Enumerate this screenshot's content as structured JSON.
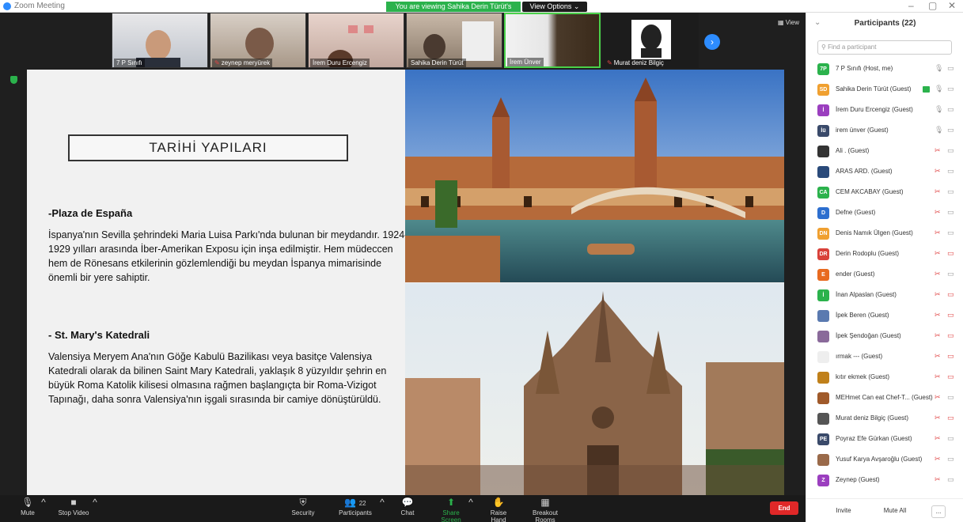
{
  "window": {
    "title": "Zoom Meeting",
    "viewing_banner": "You are viewing Sahika Derin Türüt's screen",
    "view_options": "View Options ⌄",
    "view_label": "View"
  },
  "thumbnails": [
    {
      "name": "7 P Sınıfı",
      "muted": false
    },
    {
      "name": "zeynep meryürek",
      "muted": true
    },
    {
      "name": "İrem Duru Ercengiz",
      "muted": false
    },
    {
      "name": "Sahika Derin Türüt",
      "muted": false
    },
    {
      "name": "İrem Ünver",
      "muted": false
    },
    {
      "name": "Murat deniz Bilgiç",
      "muted": true
    }
  ],
  "slide": {
    "title": "TARİHİ YAPILARI",
    "h1": "-Plaza de España",
    "p1": "İspanya'nın Sevilla şehrindeki Maria Luisa Parkı'nda bulunan bir meydandır. 1924-1929 yılları arasında İber-Amerikan Exposu için inşa edilmiştir. Hem müdeccen hem de Rönesans etkilerinin gözlemlendiği bu meydan İspanya mimarisinde önemli bir yere sahiptir.",
    "h2": "- St. Mary's Katedrali",
    "p2": "Valensiya Meryem Ana'nın Göğe Kabulü Bazilikası veya basitçe Valensiya Katedrali olarak da bilinen Saint Mary Katedrali, yaklaşık 8 yüzyıldır şehrin en büyük Roma Katolik kilisesi olmasına rağmen başlangıçta bir Roma-Vizigot Tapınağı, daha sonra Valensiya'nın işgali sırasında bir camiye dönüştürüldü."
  },
  "toolbar": {
    "mute": "Mute",
    "stop_video": "Stop Video",
    "security": "Security",
    "participants": "Participants",
    "participants_count": "22",
    "chat": "Chat",
    "share_screen": "Share Screen",
    "raise_hand": "Raise Hand",
    "breakout_rooms": "Breakout Rooms",
    "end": "End"
  },
  "panel": {
    "title": "Participants (22)",
    "search_placeholder": "Find a participant",
    "invite": "Invite",
    "mute_all": "Mute All",
    "more": "...",
    "participants": [
      {
        "initials": "7P",
        "name": "7 P Sınıfı (Host, me)",
        "color": "#2bb24c",
        "mic": "on",
        "cam": "on",
        "sharing": false
      },
      {
        "initials": "SD",
        "name": "Sahika Derin Türüt (Guest)",
        "color": "#f0a030",
        "mic": "on",
        "cam": "on",
        "sharing": true
      },
      {
        "initials": "İ",
        "name": "İrem Duru Ercengiz (Guest)",
        "color": "#9b3fbf",
        "mic": "on",
        "cam": "on",
        "sharing": false
      },
      {
        "initials": "İü",
        "name": "irem ünver (Guest)",
        "color": "#3a4a6a",
        "mic": "on",
        "cam": "on",
        "sharing": false
      },
      {
        "initials": "",
        "name": "Ali . (Guest)",
        "color": "#333333",
        "mic": "off",
        "cam": "on",
        "sharing": false
      },
      {
        "initials": "",
        "name": "ARAS ARD. (Guest)",
        "color": "#2a4a7a",
        "mic": "off",
        "cam": "on",
        "sharing": false
      },
      {
        "initials": "CA",
        "name": "CEM AKCABAY (Guest)",
        "color": "#2bb24c",
        "mic": "off",
        "cam": "on",
        "sharing": false
      },
      {
        "initials": "D",
        "name": "Defne (Guest)",
        "color": "#2d6fcf",
        "mic": "off",
        "cam": "on",
        "sharing": false
      },
      {
        "initials": "DN",
        "name": "Denis Namık Ülgen (Guest)",
        "color": "#f0a030",
        "mic": "off",
        "cam": "on",
        "sharing": false
      },
      {
        "initials": "DR",
        "name": "Derin Rodoplu (Guest)",
        "color": "#d9413a",
        "mic": "off",
        "cam": "off",
        "sharing": false
      },
      {
        "initials": "E",
        "name": "ender (Guest)",
        "color": "#e86a1f",
        "mic": "off",
        "cam": "on",
        "sharing": false
      },
      {
        "initials": "İ",
        "name": "İnan Alpaslan (Guest)",
        "color": "#2bb24c",
        "mic": "off",
        "cam": "off",
        "sharing": false
      },
      {
        "initials": "",
        "name": "İpek Beren (Guest)",
        "color": "#5a7ab0",
        "mic": "off",
        "cam": "off",
        "sharing": false
      },
      {
        "initials": "",
        "name": "İpek Şendoğan (Guest)",
        "color": "#8a6a9a",
        "mic": "off",
        "cam": "off",
        "sharing": false
      },
      {
        "initials": "",
        "name": "ırmak --- (Guest)",
        "color": "#eeeeee",
        "mic": "off",
        "cam": "off",
        "sharing": false
      },
      {
        "initials": "",
        "name": "kıtır ekmek (Guest)",
        "color": "#c0801a",
        "mic": "off",
        "cam": "off",
        "sharing": false
      },
      {
        "initials": "",
        "name": "MEHmet Can eat Chef-T... (Guest)",
        "color": "#a05a2a",
        "mic": "off",
        "cam": "on",
        "sharing": false
      },
      {
        "initials": "",
        "name": "Murat deniz Bilgiç (Guest)",
        "color": "#555555",
        "mic": "off",
        "cam": "off",
        "sharing": false
      },
      {
        "initials": "PE",
        "name": "Poyraz Efe Gürkan (Guest)",
        "color": "#3a4a6a",
        "mic": "off",
        "cam": "on",
        "sharing": false
      },
      {
        "initials": "",
        "name": "Yusuf Karya Avşaroğlu (Guest)",
        "color": "#9a6a4a",
        "mic": "off",
        "cam": "on",
        "sharing": false
      },
      {
        "initials": "Z",
        "name": "Zeynep (Guest)",
        "color": "#9b3fbf",
        "mic": "off",
        "cam": "on",
        "sharing": false
      }
    ]
  }
}
